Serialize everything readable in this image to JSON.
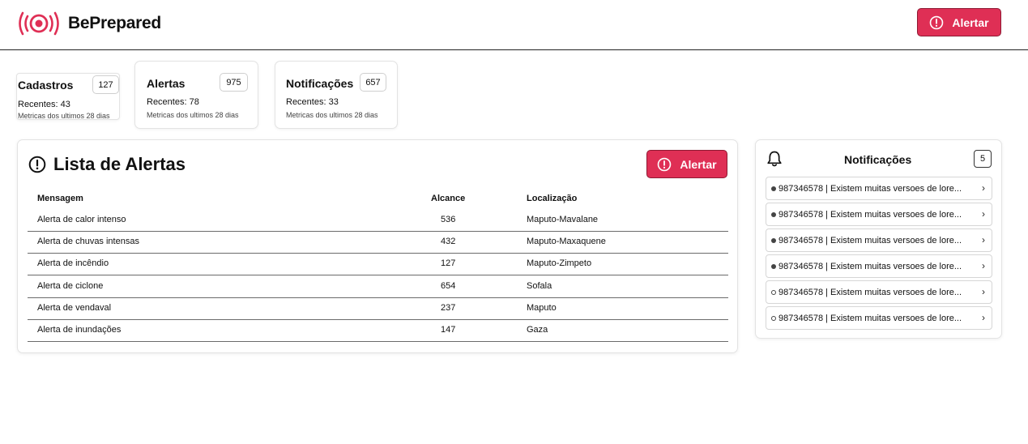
{
  "header": {
    "brand": "BePrepared",
    "alert_button": "Alertar"
  },
  "stats": [
    {
      "title": "Cadastros",
      "count": "127",
      "recent": "Recentes: 43",
      "metric": "Metricas dos ultimos 28 dias"
    },
    {
      "title": "Alertas",
      "count": "975",
      "recent": "Recentes: 78",
      "metric": "Metricas dos ultimos 28 dias"
    },
    {
      "title": "Notificações",
      "count": "657",
      "recent": "Recentes: 33",
      "metric": "Metricas dos ultimos 28 dias"
    }
  ],
  "alerts_list": {
    "title": "Lista de Alertas",
    "button": "Alertar",
    "columns": [
      "Mensagem",
      "Alcance",
      "Localização"
    ],
    "rows": [
      [
        "Alerta de calor intenso",
        "536",
        "Maputo-Mavalane"
      ],
      [
        "Alerta de chuvas intensas",
        "432",
        "Maputo-Maxaquene"
      ],
      [
        "Alerta de incêndio",
        "127",
        "Maputo-Zimpeto"
      ],
      [
        "Alerta de ciclone",
        "654",
        "Sofala"
      ],
      [
        "Alerta de vendaval",
        "237",
        "Maputo"
      ],
      [
        "Alerta de inundações",
        "147",
        "Gaza"
      ]
    ]
  },
  "notifications": {
    "title": "Notificações",
    "count": "5",
    "items": [
      {
        "text": "987346578 | Existem muitas versoes de lore...",
        "read": false
      },
      {
        "text": "987346578 | Existem muitas versoes de lore...",
        "read": false
      },
      {
        "text": "987346578 | Existem muitas versoes de lore...",
        "read": false
      },
      {
        "text": "987346578 | Existem muitas versoes de lore...",
        "read": false
      },
      {
        "text": "987346578 | Existem muitas versoes de lore...",
        "read": true
      },
      {
        "text": "987346578 | Existem muitas versoes de lore...",
        "read": true
      }
    ]
  },
  "colors": {
    "accent": "#df2f55",
    "border": "#e3e3e3"
  }
}
